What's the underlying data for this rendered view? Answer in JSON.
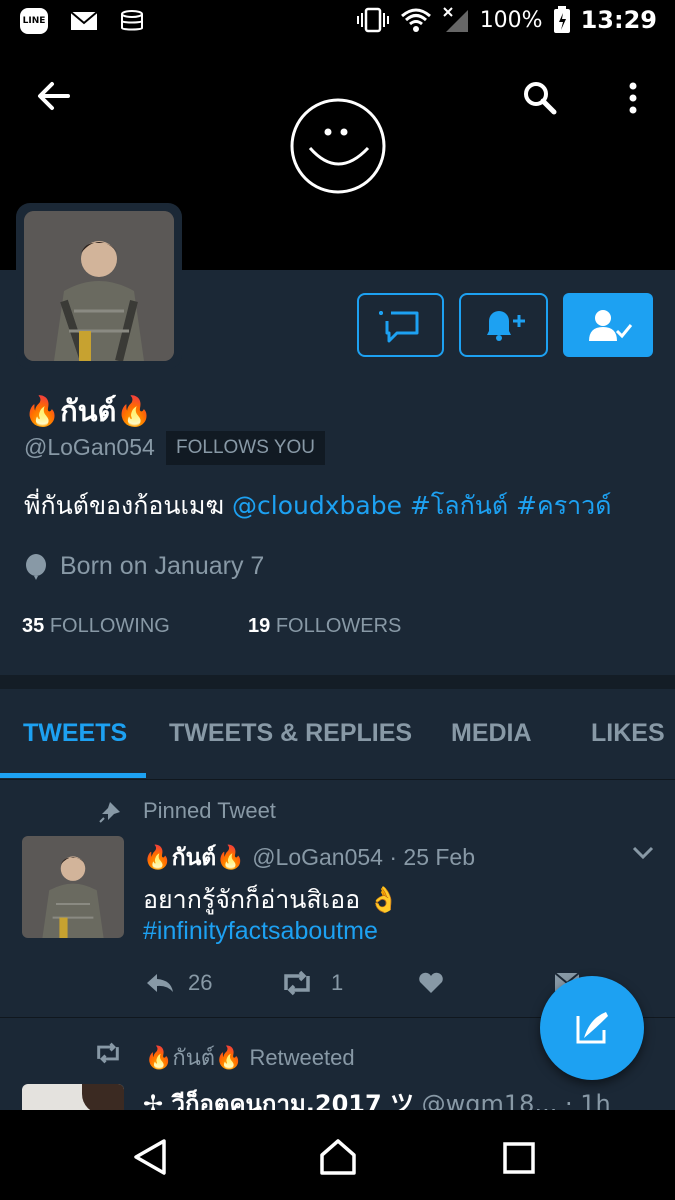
{
  "status_bar": {
    "line_app": "LINE",
    "battery": "100%",
    "time": "13:29"
  },
  "profile": {
    "display_name": "🔥กันต์🔥",
    "handle": "@LoGan054",
    "follows_you": "FOLLOWS YOU",
    "bio_text": "พี่กันต์ของก้อนเมฆ",
    "bio_mention": "@cloudxbabe",
    "bio_tags": "#โลกันต์ #คราวด์",
    "birthday": "Born on January 7",
    "following_count": "35",
    "following_label": "FOLLOWING",
    "followers_count": "19",
    "followers_label": "FOLLOWERS"
  },
  "tabs": [
    {
      "label": "TWEETS",
      "active": true
    },
    {
      "label": "TWEETS & REPLIES",
      "active": false
    },
    {
      "label": "MEDIA",
      "active": false
    },
    {
      "label": "LIKES",
      "active": false
    }
  ],
  "pinned_tweet": {
    "context": "Pinned Tweet",
    "name": "🔥กันต์🔥",
    "handle_date": "@LoGan054 · 25 Feb",
    "text": "อยากรู้จักก็อ่านสิเออ 👌",
    "hashtag": "#infinityfactsaboutme",
    "replies": "26",
    "retweets": "1"
  },
  "retweet": {
    "context_name": "🔥กันต์🔥",
    "context_label": "Retweeted",
    "name": "✢ วีก็อตคนกาม,2017 ツ",
    "handle": "@wgm18...",
    "time": "· 1h"
  },
  "colors": {
    "accent": "#1da1f2",
    "background": "#1b2836",
    "muted": "#8899a6"
  }
}
